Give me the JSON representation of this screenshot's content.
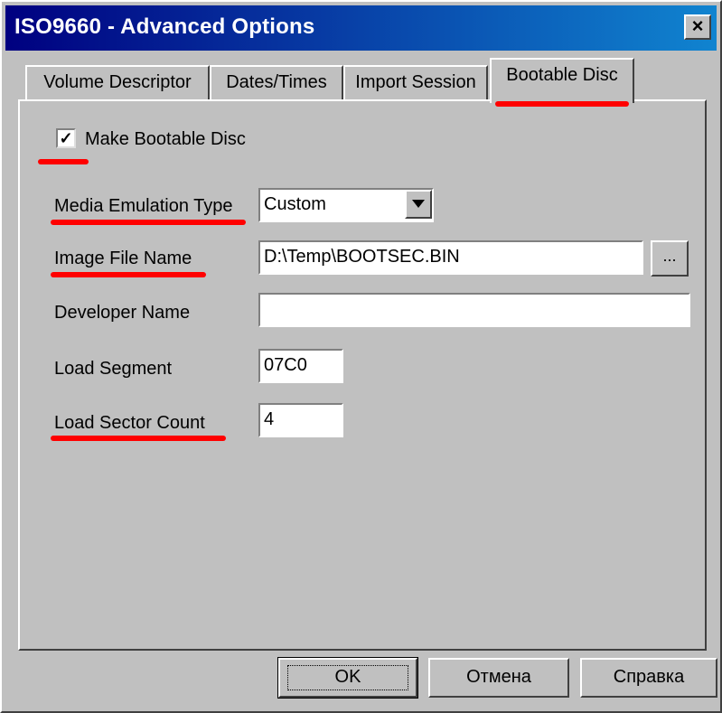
{
  "window": {
    "title": "ISO9660 - Advanced Options",
    "close_glyph": "×"
  },
  "tabs": [
    {
      "label": "Volume Descriptor",
      "active": false
    },
    {
      "label": "Dates/Times",
      "active": false
    },
    {
      "label": "Import Session",
      "active": false
    },
    {
      "label": "Bootable Disc",
      "active": true
    }
  ],
  "bootable": {
    "make_bootable_label": "Make Bootable Disc",
    "make_bootable_checked": true,
    "check_glyph": "✓",
    "media_emulation_label": "Media Emulation Type",
    "media_emulation_value": "Custom",
    "image_file_label": "Image File Name",
    "image_file_value": "D:\\Temp\\BOOTSEC.BIN",
    "browse_label": "...",
    "developer_label": "Developer Name",
    "developer_value": "",
    "load_segment_label": "Load Segment",
    "load_segment_value": "07C0",
    "load_sector_count_label": "Load Sector Count",
    "load_sector_count_value": "4"
  },
  "buttons": {
    "ok": "OK",
    "cancel": "Отмена",
    "help": "Справка"
  },
  "colors": {
    "title_start": "#000080",
    "title_end": "#1084d0",
    "face": "#c0c0c0",
    "annotation": "#ff0000"
  },
  "icons": [
    "checkbox-check-icon",
    "dropdown-arrow-icon",
    "close-icon"
  ]
}
